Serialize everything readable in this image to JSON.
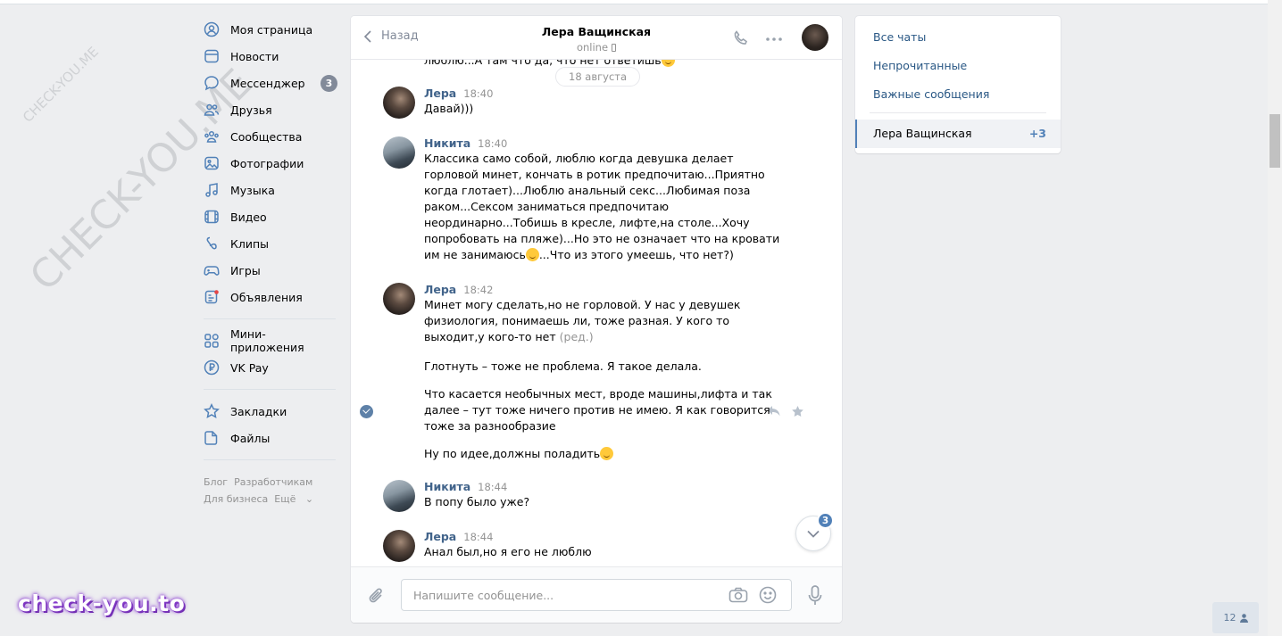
{
  "watermarks": {
    "small": "CHECK-YOU.ME",
    "big": "CHECK-YOU.ME"
  },
  "nav": {
    "items": [
      {
        "label": "Моя страница",
        "icon": "user-circle-icon"
      },
      {
        "label": "Новости",
        "icon": "news-icon"
      },
      {
        "label": "Мессенджер",
        "icon": "message-icon",
        "badge": "3"
      },
      {
        "label": "Друзья",
        "icon": "friends-icon"
      },
      {
        "label": "Сообщества",
        "icon": "communities-icon"
      },
      {
        "label": "Фотографии",
        "icon": "photo-icon"
      },
      {
        "label": "Музыка",
        "icon": "music-icon"
      },
      {
        "label": "Видео",
        "icon": "video-icon"
      },
      {
        "label": "Клипы",
        "icon": "clips-icon"
      },
      {
        "label": "Игры",
        "icon": "gamepad-icon"
      },
      {
        "label": "Объявления",
        "icon": "ads-icon"
      }
    ],
    "apps": [
      {
        "label": "Мини-приложения",
        "icon": "apps-grid-icon"
      },
      {
        "label": "VK Pay",
        "icon": "vkpay-icon"
      }
    ],
    "saved": [
      {
        "label": "Закладки",
        "icon": "star-icon"
      },
      {
        "label": "Файлы",
        "icon": "file-icon"
      }
    ],
    "footer": {
      "blog": "Блог",
      "dev": "Разработчикам",
      "business": "Для бизнеса",
      "more": "Ещё"
    }
  },
  "chat": {
    "back_label": "Назад",
    "name": "Лера Ващинская",
    "status": "online",
    "cut_line": "люблю...А там что да, что нет ответишь",
    "date_pill": "18 августа",
    "messages": [
      {
        "author": "Лера",
        "time": "18:40",
        "text": "Давай)))"
      },
      {
        "author": "Никита",
        "time": "18:40",
        "text_a": "Классика само собой, люблю когда девушка делает горловой минет, кончать в ротик предпочитаю...Приятно когда глотает)...Люблю анальный секс...Любимая поза раком...Сексом заниматься предпочитаю неординарно...Тобишь в кресле, лифте,на столе...Хочу попробовать на пляже)...Но это не означает что на кровати им не занимаюсь",
        "text_b": "...Что из этого умеешь, что нет?)"
      },
      {
        "author": "Лера",
        "time": "18:42",
        "text": "Минет могу сделать,но не горловой. У нас у девушек физиология, понимаешь ли, тоже разная. У кого то выходит,у кого-то нет",
        "edited": "(ред.)"
      },
      {
        "author": "Никита",
        "time": "18:44",
        "text": "В попу было уже?"
      },
      {
        "author": "Лера",
        "time": "18:44",
        "text": "Анал был,но я его не люблю"
      }
    ],
    "continuation": [
      "Глотнуть – тоже не проблема. Я такое делала.",
      "Что касается необычных мест, вроде машины,лифта и так далее – тут тоже ничего против не имею. Я как говорится тоже за разнообразие",
      "Ну по идее,должны поладить"
    ],
    "unread_badge": "3",
    "composer_placeholder": "Напишите сообщение..."
  },
  "right_panel": {
    "all_chats": "Все чаты",
    "unread": "Непрочитанные",
    "important": "Важные сообщения",
    "active_chat": "Лера Ващинская",
    "active_count": "+3"
  },
  "brand": "check-you.to",
  "online_count": "12",
  "colors": {
    "accent": "#5181b8",
    "link": "#2a5885",
    "author": "#42648b",
    "background": "#edeef0"
  }
}
